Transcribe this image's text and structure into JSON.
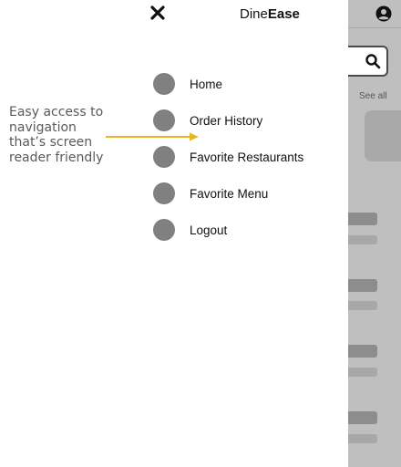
{
  "app": {
    "brand_regular": "Dine",
    "brand_bold": "Ease"
  },
  "drawer": {
    "close_icon": "close-icon",
    "menu_items": [
      {
        "label": "Home",
        "icon": "placeholder-circle-icon"
      },
      {
        "label": "Order History",
        "icon": "placeholder-circle-icon"
      },
      {
        "label": "Favorite Restaurants",
        "icon": "placeholder-circle-icon"
      },
      {
        "label": "Favorite Menu",
        "icon": "placeholder-circle-icon"
      },
      {
        "label": "Logout",
        "icon": "placeholder-circle-icon"
      }
    ]
  },
  "annotation": {
    "text": "Easy access to navigation that’s screen reader friendly",
    "arrow_color": "#e7b623"
  },
  "background_screen": {
    "see_all_label": "See all",
    "search_icon": "search-icon",
    "user_icon": "user-account-icon"
  },
  "colors": {
    "overlay": "#bfbfbf",
    "menu_dot": "#808080",
    "text": "#111111"
  }
}
